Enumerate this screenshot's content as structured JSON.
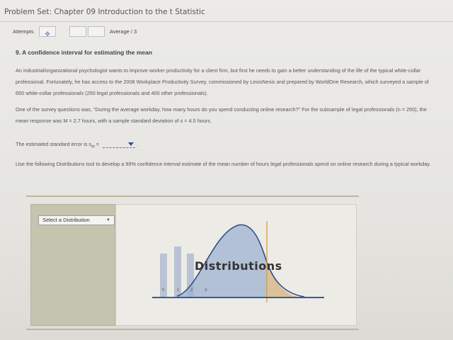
{
  "header": {
    "title": "Problem Set: Chapter 09 Introduction to the t Statistic"
  },
  "attempts": {
    "label": "Attempts",
    "average": "Average / 3"
  },
  "question": {
    "heading": "9. A confidence interval for estimating the mean",
    "paragraph1": "An industrial/organizational psychologist wants to improve worker productivity for a client firm, but first he needs to gain a better understanding of the life of the typical white-collar professional. Fortunately, he has access to the 2008 Workplace Productivity Survey, commissioned by LexisNexis and prepared by WorldOne Research, which surveyed a sample of 650 white-collar professionals (250 legal professionals and 400 other professionals).",
    "paragraph2": "One of the survey questions was, “During the average workday, how many hours do you spend conducting online research?” For the subsample of legal professionals (n = 250), the mean response was M = 2.7 hours, with a sample standard deviation of s = 4.5 hours.",
    "se_prompt": "The estimated standard error is s",
    "se_sub": "M",
    "se_equals": " =",
    "se_end": " .",
    "paragraph4": "Use the following Distributions tool to develop a 99% confidence interval estimate of the mean number of hours legal professionals spend on online research during a typical workday."
  },
  "tool": {
    "select_label": "Select a Distribution",
    "graphic_title": "Distributions",
    "axis_ticks": [
      "0",
      "1",
      "2",
      "3"
    ]
  },
  "colors": {
    "bar": "#b9c3d3",
    "curve_fill": "#9fb3cf",
    "tail_fill": "#d9b98a",
    "tail_line": "#d99a3a",
    "axis": "#3a5a9a"
  }
}
